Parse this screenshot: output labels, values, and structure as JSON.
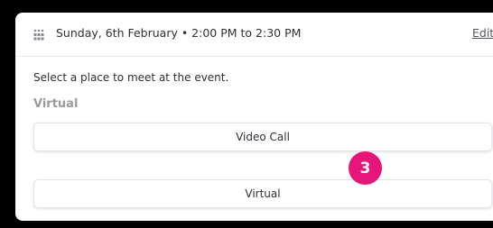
{
  "event": {
    "date_icon": "calendar-people-icon",
    "date_time": "Sunday, 6th February • 2:00 PM to 2:30 PM",
    "edit_label": "Edit"
  },
  "instruction": "Select a place to meet at the event.",
  "section": {
    "label": "Virtual",
    "options": [
      {
        "label": "Video Call"
      },
      {
        "label": "Virtual"
      }
    ]
  },
  "step_badge": "3",
  "colors": {
    "background": "#000000",
    "panel": "#ffffff",
    "badge": "#e5157a",
    "text": "#2f2f3a",
    "muted": "#9a9aa4"
  }
}
